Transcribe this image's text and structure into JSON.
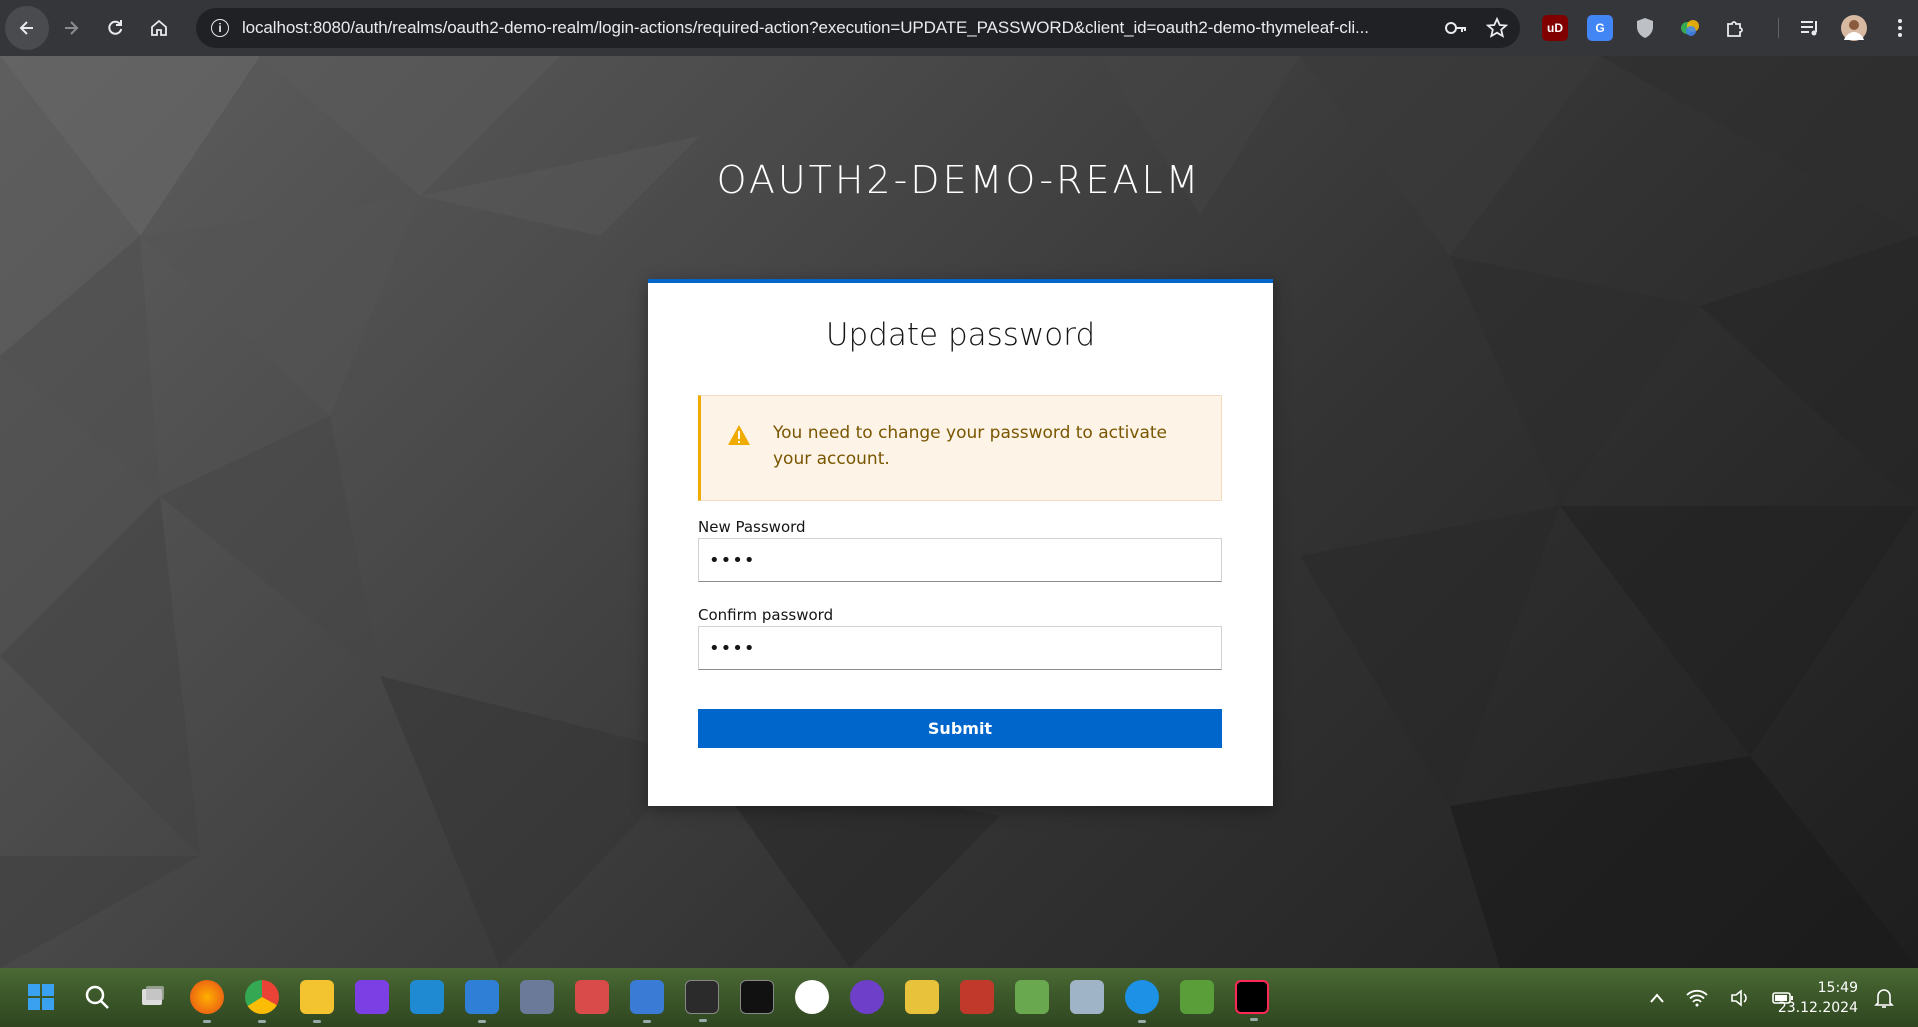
{
  "browser": {
    "url": "localhost:8080/auth/realms/oauth2-demo-realm/login-actions/required-action?execution=UPDATE_PASSWORD&client_id=oauth2-demo-thymeleaf-cli...",
    "extensions": [
      "ublock-origin-icon",
      "google-translate-icon",
      "privacy-badger-icon",
      "colorful-extension-icon",
      "extensions-puzzle-icon"
    ],
    "ublock_label": "uD",
    "translate_label": "G"
  },
  "page": {
    "realm_title": "OAUTH2-DEMO-REALM",
    "card_title": "Update password",
    "alert_text": "You need to change your password to activate your account.",
    "new_password_label": "New Password",
    "new_password_value": "••••",
    "confirm_password_label": "Confirm password",
    "confirm_password_value": "••••",
    "submit_label": "Submit",
    "accent_color": "#0066cc",
    "warning_color": "#f0ab00"
  },
  "taskbar": {
    "time": "15:49",
    "date": "23.12.2024"
  }
}
